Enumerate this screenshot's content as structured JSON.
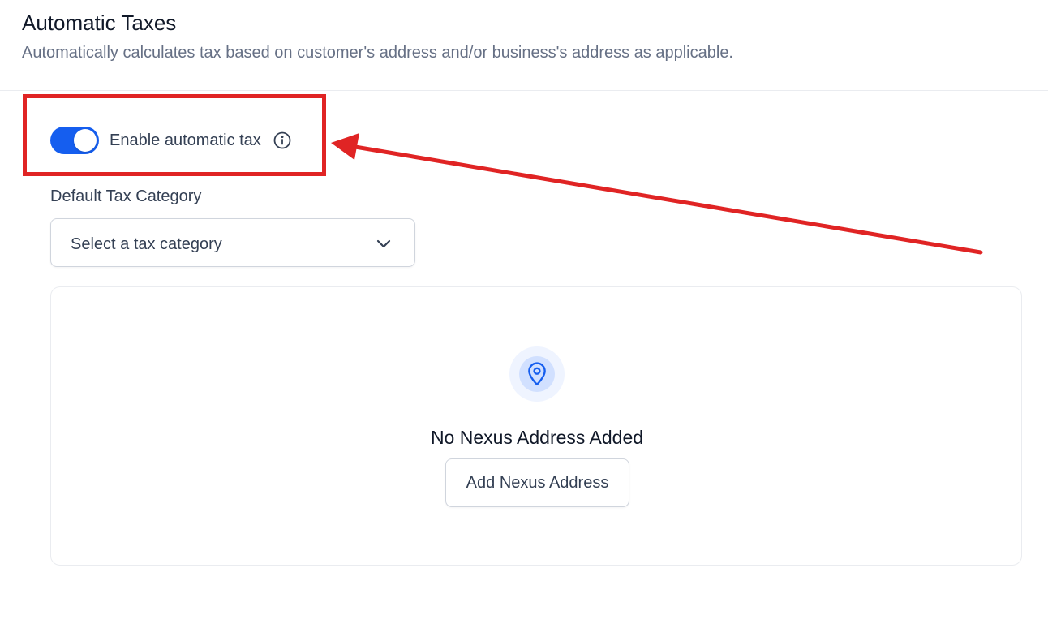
{
  "header": {
    "title": "Automatic Taxes",
    "subtitle": "Automatically calculates tax based on customer's address and/or business's address as applicable."
  },
  "auto_tax": {
    "toggle_on": true,
    "label": "Enable automatic tax",
    "info_icon": "info-circle-icon"
  },
  "tax_category": {
    "label": "Default Tax Category",
    "placeholder": "Select a tax category",
    "chevron_icon": "chevron-down-icon"
  },
  "nexus": {
    "icon": "map-pin-icon",
    "empty_title": "No Nexus Address Added",
    "add_button_label": "Add Nexus Address"
  },
  "colors": {
    "accent": "#155eef",
    "annotation": "#e02424"
  }
}
